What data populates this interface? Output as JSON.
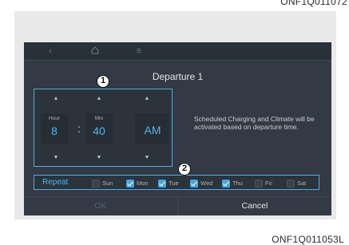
{
  "document_code_top": "ONF1Q011072",
  "document_code_bottom": "ONF1Q011053L",
  "dialog": {
    "title": "Departure 1",
    "hour": {
      "label": "Hour",
      "value": "8"
    },
    "minute": {
      "label": "Min",
      "value": "40"
    },
    "separator": ":",
    "ampm": "AM",
    "info_text": "Scheduled Charging and Climate will be activated based on departure time.",
    "repeat_label": "Repeat",
    "days": [
      {
        "label": "Sun",
        "checked": false
      },
      {
        "label": "Mon",
        "checked": true
      },
      {
        "label": "Tue",
        "checked": true
      },
      {
        "label": "Wed",
        "checked": true
      },
      {
        "label": "Thu",
        "checked": true
      },
      {
        "label": "Fri",
        "checked": false
      },
      {
        "label": "Sat",
        "checked": false
      }
    ],
    "ok_label": "OK",
    "cancel_label": "Cancel"
  },
  "callouts": [
    "1",
    "2"
  ],
  "icons": {
    "back": "back-arrow-icon",
    "home": "home-icon",
    "menu": "menu-icon"
  },
  "colors": {
    "accent": "#4bb0e3",
    "screen_bg": "#333a43",
    "text": "#e4e7ea"
  }
}
